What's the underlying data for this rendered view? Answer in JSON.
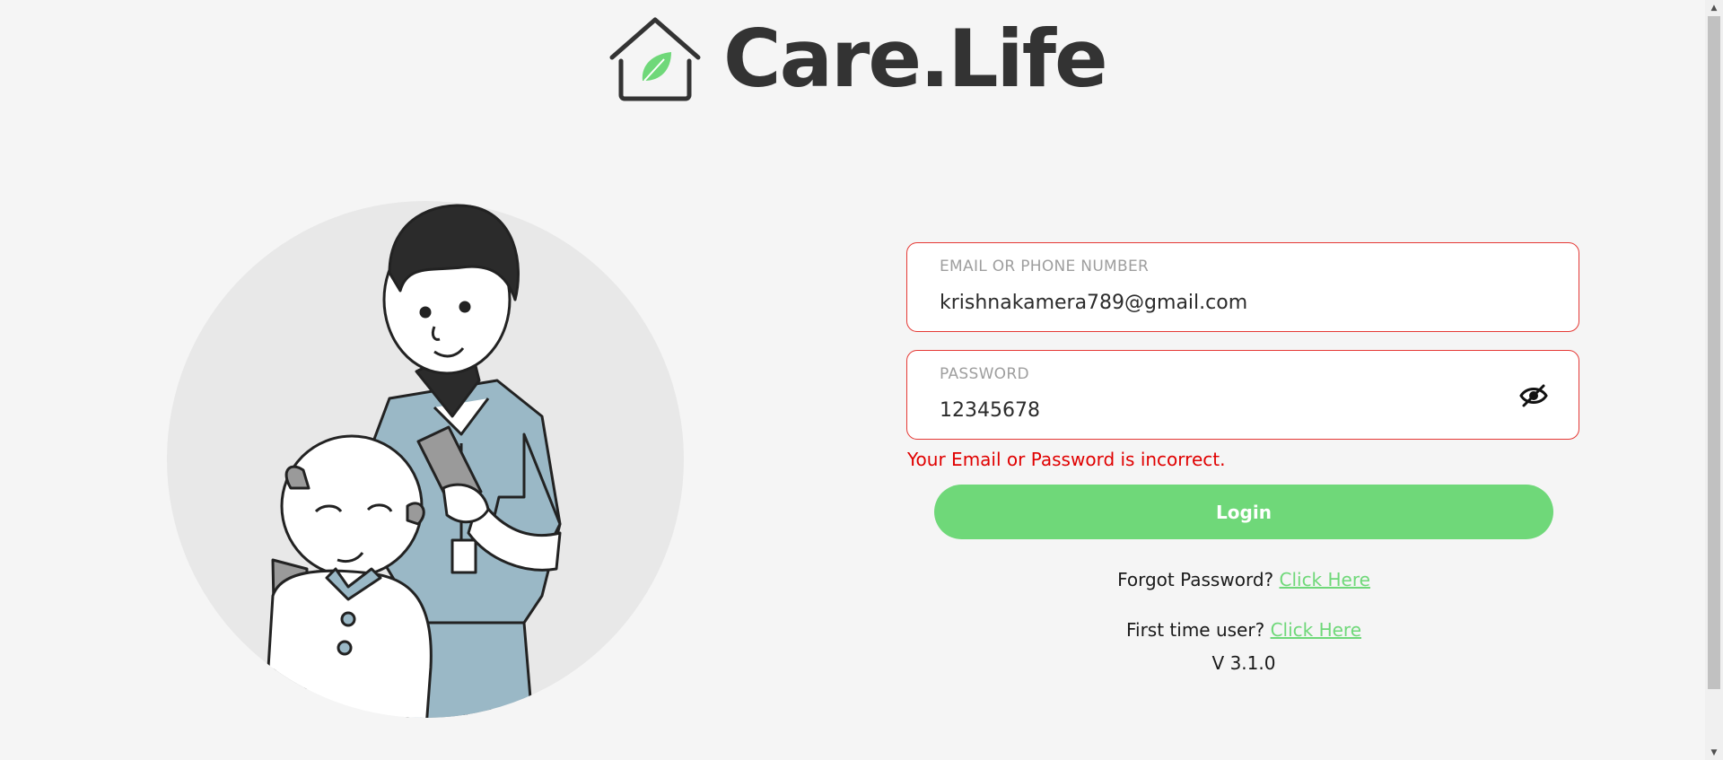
{
  "brand": {
    "name": "Care.Life",
    "leaf_color": "#6fd879"
  },
  "form": {
    "email": {
      "label": "EMAIL OR PHONE NUMBER",
      "value": "krishnakamera789@gmail.com"
    },
    "password": {
      "label": "PASSWORD",
      "value": "12345678",
      "toggle_icon": "eye-slash-icon"
    },
    "error": "Your Email or Password is incorrect.",
    "login_label": "Login"
  },
  "links": {
    "forgot_prefix": "Forgot Password?",
    "forgot_link": "Click Here",
    "first_prefix": "First time user?",
    "first_link": "Click Here"
  },
  "version": "V 3.1.0",
  "colors": {
    "accent": "#6fd879",
    "error": "#e00000",
    "text": "#333333"
  }
}
